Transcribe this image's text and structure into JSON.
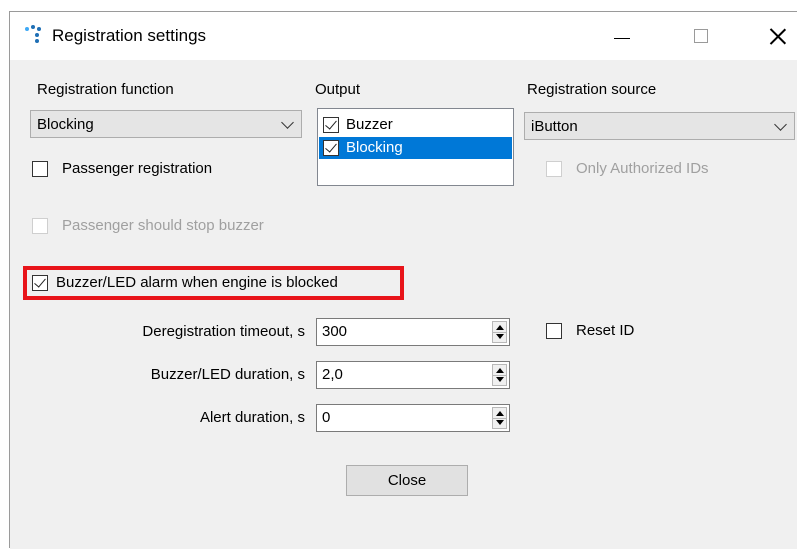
{
  "window": {
    "title": "Registration settings"
  },
  "registration_function": {
    "label": "Registration function",
    "selected": "Blocking",
    "passenger_registration": {
      "label": "Passenger registration",
      "checked": false
    }
  },
  "output": {
    "label": "Output",
    "items": [
      {
        "label": "Buzzer",
        "checked": true,
        "selected": false
      },
      {
        "label": "Blocking",
        "checked": true,
        "selected": true
      }
    ]
  },
  "registration_source": {
    "label": "Registration source",
    "selected": "iButton",
    "only_authorized": {
      "label": "Only Authorized IDs",
      "checked": false,
      "enabled": false
    }
  },
  "passenger_stop_buzzer": {
    "label": "Passenger should stop buzzer",
    "checked": false,
    "enabled": false
  },
  "buzzer_alarm": {
    "label": "Buzzer/LED alarm when engine is blocked",
    "checked": true
  },
  "fields": {
    "deregistration_timeout": {
      "label": "Deregistration timeout, s",
      "value": "300"
    },
    "buzzer_duration": {
      "label": "Buzzer/LED duration, s",
      "value": "2,0"
    },
    "alert_duration": {
      "label": "Alert duration, s",
      "value": "0"
    }
  },
  "reset_id": {
    "label": "Reset ID",
    "checked": false
  },
  "close_button": {
    "label": "Close"
  },
  "colors": {
    "selection": "#0078d7",
    "highlight_border": "#e8141a"
  }
}
